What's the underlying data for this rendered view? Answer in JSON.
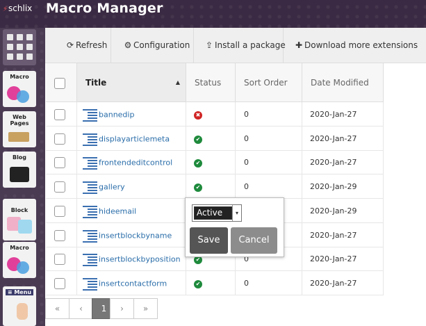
{
  "app": {
    "logo_text": "schlix",
    "logo_mark": "⚡",
    "title": "Macro Manager"
  },
  "sidebar": {
    "tiles": [
      {
        "name": "apps-grid",
        "label": ""
      },
      {
        "name": "macro",
        "label": "Macro"
      },
      {
        "name": "web-pages",
        "label": "Web Pages"
      },
      {
        "name": "blog",
        "label": "Blog"
      },
      {
        "name": "block",
        "label": "Block"
      },
      {
        "name": "macro-2",
        "label": "Macro"
      },
      {
        "name": "menu",
        "label": "≡ Menu"
      }
    ]
  },
  "toolbar": {
    "refresh": {
      "icon": "refresh-icon",
      "glyph": "⟳",
      "label": "Refresh"
    },
    "configuration": {
      "icon": "gear-icon",
      "glyph": "⚙",
      "label": "Configuration"
    },
    "install": {
      "icon": "upload-icon",
      "glyph": "⇪",
      "label": "Install a package"
    },
    "download": {
      "icon": "puzzle-icon",
      "glyph": "✚",
      "label": "Download more extensions"
    }
  },
  "table": {
    "headers": {
      "title": "Title",
      "status": "Status",
      "sort_order": "Sort Order",
      "date_modified": "Date Modified"
    },
    "sort_arrow": "▲",
    "rows": [
      {
        "title": "bannedip",
        "status": "disabled",
        "sort_order": "0",
        "date": "2020-Jan-27"
      },
      {
        "title": "displayarticlemeta",
        "status": "enabled",
        "sort_order": "0",
        "date": "2020-Jan-27"
      },
      {
        "title": "frontendeditcontrol",
        "status": "enabled",
        "sort_order": "0",
        "date": "2020-Jan-27"
      },
      {
        "title": "gallery",
        "status": "enabled",
        "sort_order": "0",
        "date": "2020-Jan-29"
      },
      {
        "title": "hideemail",
        "status": "",
        "sort_order": "",
        "date": "2020-Jan-29"
      },
      {
        "title": "insertblockbyname",
        "status": "",
        "sort_order": "",
        "date": "2020-Jan-27"
      },
      {
        "title": "insertblockbyposition",
        "status": "enabled",
        "sort_order": "0",
        "date": "2020-Jan-27"
      },
      {
        "title": "insertcontactform",
        "status": "enabled",
        "sort_order": "0",
        "date": "2020-Jan-27"
      }
    ]
  },
  "pager": {
    "first": "«",
    "prev": "‹",
    "current": "1",
    "next": "›",
    "last": "»"
  },
  "status_popup": {
    "selected": "Active",
    "caret": "▾",
    "save_label": "Save",
    "cancel_label": "Cancel"
  },
  "colors": {
    "accent_link": "#2a6da9",
    "ok": "#1e8a3c",
    "error": "#d02525",
    "topbar": "#3b2a43"
  }
}
